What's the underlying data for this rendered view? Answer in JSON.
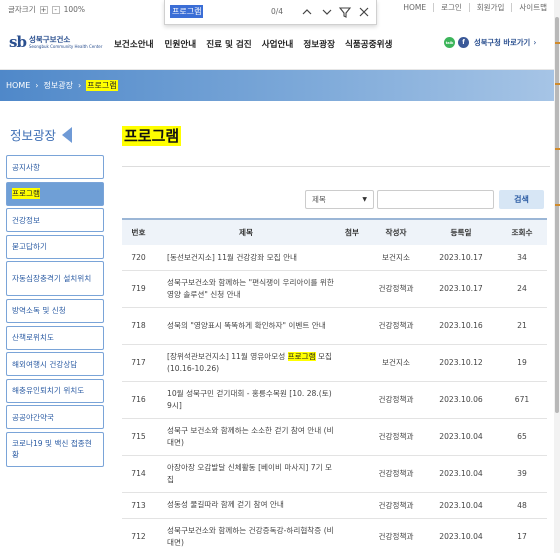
{
  "utility": {
    "font_size_label": "글자크기",
    "plus": "+",
    "minus": "-",
    "zoom": "100%",
    "links": [
      "HOME",
      "로그인",
      "회원가입",
      "사이트맵"
    ]
  },
  "findbar": {
    "query": "프로그램",
    "count": "0/4"
  },
  "logo": {
    "mark": "sb",
    "name": "성북구보건소",
    "sub": "Seongbuk Community Health Center"
  },
  "gnb": [
    "보건소안내",
    "민원안내",
    "진료 및 검진",
    "사업안내",
    "정보광장",
    "식품공중위생"
  ],
  "shortcut": {
    "label": "성북구청 바로가기",
    "talk_icon_text": "talk",
    "fb_icon_text": "f"
  },
  "breadcrumb": [
    "HOME",
    "정보광장",
    "프로그램"
  ],
  "side": {
    "title": "정보광장",
    "items": [
      {
        "label": "공지사항",
        "active": false
      },
      {
        "label": "프로그램",
        "active": true
      },
      {
        "label": "건강정보",
        "active": false
      },
      {
        "label": "묻고답하기",
        "active": false
      },
      {
        "label": "자동심장충격기 설치위치",
        "active": false
      },
      {
        "label": "방역소독 및 신청",
        "active": false
      },
      {
        "label": "산책로위치도",
        "active": false
      },
      {
        "label": "해외여행시 건강상담",
        "active": false
      },
      {
        "label": "해충유인퇴치기 위치도",
        "active": false
      },
      {
        "label": "공공야간약국",
        "active": false
      },
      {
        "label": "코로나19 및 백신 접종현황",
        "active": false
      }
    ]
  },
  "page_title": "프로그램",
  "search": {
    "select_value": "제목",
    "input_value": "",
    "button": "검색"
  },
  "table": {
    "headers": [
      "번호",
      "제목",
      "첨부",
      "작성자",
      "등록일",
      "조회수"
    ],
    "rows": [
      {
        "no": "720",
        "title": "[동선보건지소] 11월 건강강좌 모집 안내",
        "att": "",
        "author": "보건지소",
        "date": "2023.10.17",
        "views": "34"
      },
      {
        "no": "719",
        "title": "성북구보건소와 함께하는 \"편식쟁이 우리아이를 위한 영양 솔루션\" 신청 안내",
        "att": "",
        "author": "건강정책과",
        "date": "2023.10.17",
        "views": "24"
      },
      {
        "no": "718",
        "title": "성북의 \"영양표시 똑똑하게 확인하자\" 이벤트 안내",
        "att": "",
        "author": "건강정책과",
        "date": "2023.10.16",
        "views": "21"
      },
      {
        "no": "717",
        "title_before": "[장위석관보건지소] 11월 영유아모성 ",
        "title_hl": "프로그램",
        "title_after": " 모집(10.16-10.26)",
        "att": "",
        "author": "보건지소",
        "date": "2023.10.12",
        "views": "19"
      },
      {
        "no": "716",
        "title": "10월 성북구민 걷기대회 - 홍릉수목원 [10. 28.(토) 9시]",
        "att": "",
        "author": "건강정책과",
        "date": "2023.10.06",
        "views": "671"
      },
      {
        "no": "715",
        "title": "성북구 보건소와 함께하는 소소한 걷기 참여 안내 (비대면)",
        "att": "",
        "author": "건강정책과",
        "date": "2023.10.04",
        "views": "65"
      },
      {
        "no": "714",
        "title": "아장아장 오감발달 신체활동 [베이비 마사지] 7기 모집",
        "att": "",
        "author": "건강정책과",
        "date": "2023.10.04",
        "views": "39"
      },
      {
        "no": "713",
        "title": "성동성 물길따라 함께 걷기 참여 안내",
        "att": "",
        "author": "건강정책과",
        "date": "2023.10.04",
        "views": "48"
      },
      {
        "no": "712",
        "title": "성북구보건소와 함께하는 건강증독강-하리협착증 (비대면)",
        "att": "",
        "author": "건강정책과",
        "date": "2023.10.04",
        "views": "17"
      }
    ]
  },
  "colors": {
    "accent": "#3f6fb5",
    "highlight": "#ffff00",
    "banner_start": "#4f88c9"
  }
}
